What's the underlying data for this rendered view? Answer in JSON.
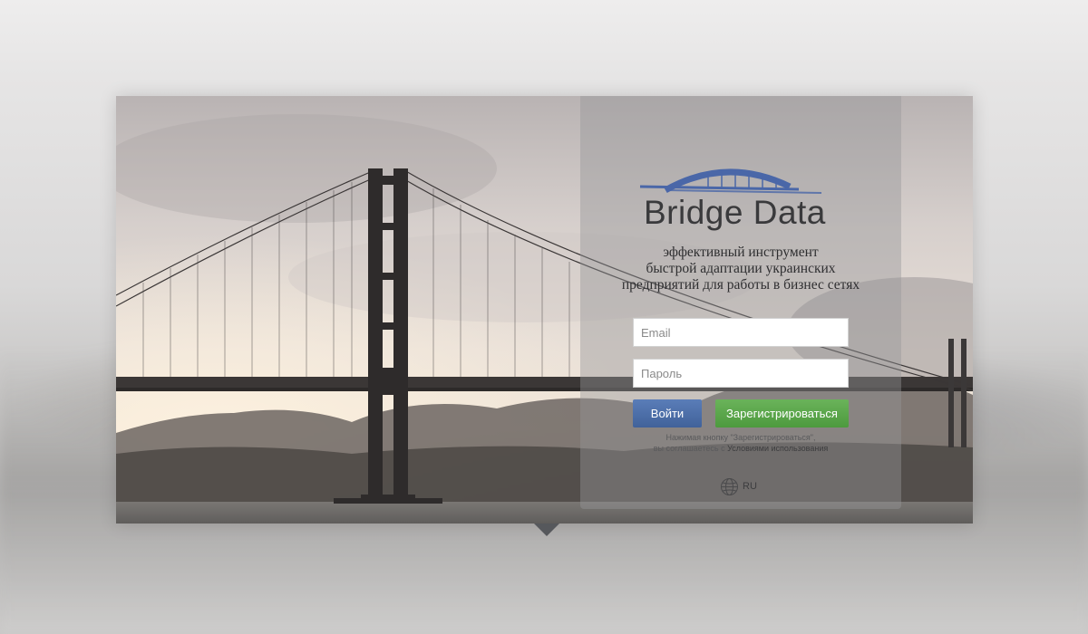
{
  "brand": {
    "name": "Bridge Data",
    "logo_icon": "bridge-arch-logo"
  },
  "tagline": {
    "line1": "эффективный инструмент",
    "line2": "быстрой адаптации украинских",
    "line3": "предприятий для работы в бизнес сетях"
  },
  "form": {
    "email_placeholder": "Email",
    "password_placeholder": "Пароль",
    "login_label": "Войти",
    "register_label": "Зарегистрироваться",
    "terms_line1": "Нажимая кнопку \"Зарегистрироваться\",",
    "terms_line2_prefix": "вы соглашаетесь с",
    "terms_link": "Условиями использования"
  },
  "language": {
    "code": "RU",
    "icon": "globe-icon"
  },
  "colors": {
    "login_button": "#4a6ca6",
    "register_button": "#5aa84a",
    "logo_blue": "#4a67a8"
  }
}
